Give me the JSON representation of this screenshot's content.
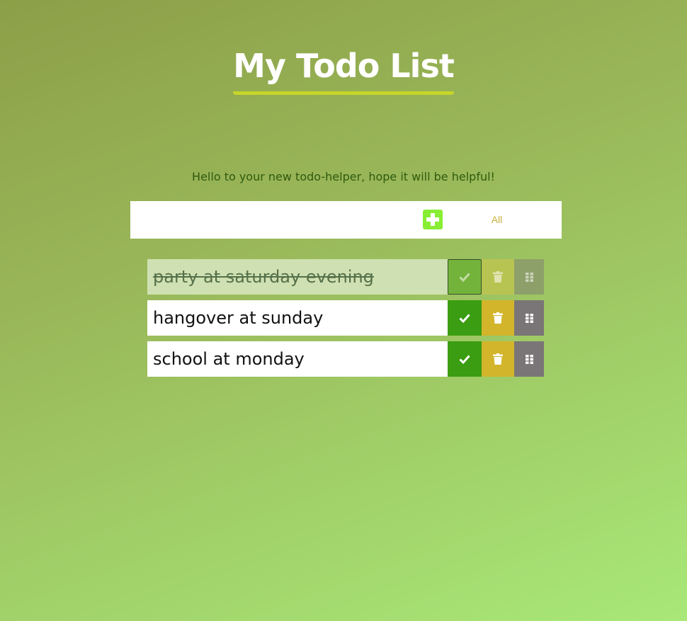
{
  "header": {
    "title": "My Todo List"
  },
  "intro": {
    "text": "Hello to your new todo-helper, hope it will be helpful!"
  },
  "toolbar": {
    "add_icon": "plus-square-icon",
    "filter_value": "All",
    "add_button_color": "#88ee33",
    "filter_text_color": "#c9b03a"
  },
  "todos": [
    {
      "text": "party at saturday evening",
      "completed": true
    },
    {
      "text": "hangover at sunday",
      "completed": false
    },
    {
      "text": "school at monday",
      "completed": false
    }
  ],
  "icons": {
    "complete": "check-icon",
    "delete": "trash-icon",
    "drag": "grip-icon"
  },
  "colors": {
    "title_underline": "#c6d52a",
    "complete_button": "#3b9d12",
    "delete_button": "#d2b52a",
    "drag_button": "#7a7577",
    "intro_text": "#2f5a0e"
  }
}
